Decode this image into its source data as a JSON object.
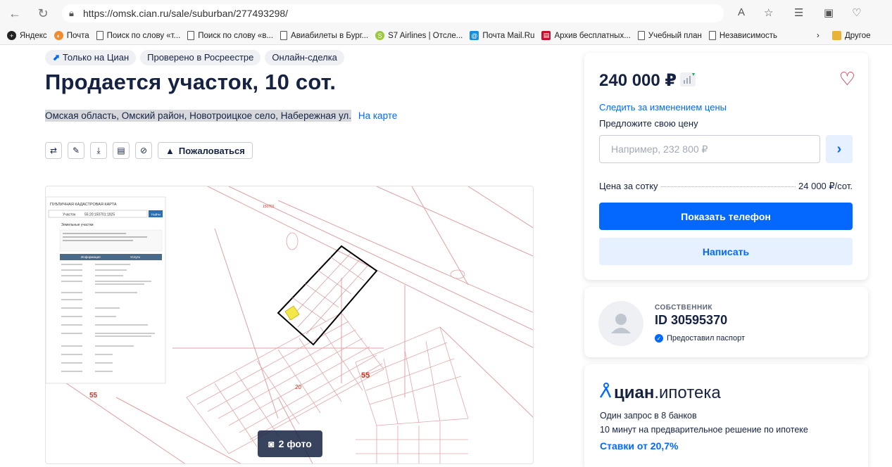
{
  "browser": {
    "url": "https://omsk.cian.ru/sale/suburban/277493298/",
    "bookmarks": [
      {
        "label": "Яндекс",
        "icon": "plus-icon"
      },
      {
        "label": "Почта",
        "icon": "mail-icon"
      },
      {
        "label": "Поиск по слову «т...",
        "icon": "page-icon"
      },
      {
        "label": "Поиск по слову «в...",
        "icon": "page-icon"
      },
      {
        "label": "Авиабилеты в Бург...",
        "icon": "page-icon"
      },
      {
        "label": "S7 Airlines | Отсле...",
        "icon": "s7-icon"
      },
      {
        "label": "Почта Mail.Ru",
        "icon": "mailru-icon"
      },
      {
        "label": "Архив бесплатных...",
        "icon": "archive-icon"
      },
      {
        "label": "Учебный план",
        "icon": "page-icon"
      },
      {
        "label": "Независимость",
        "icon": "page-icon"
      }
    ],
    "other_bookmarks": "Другое"
  },
  "listing": {
    "badges": [
      "Только на Циан",
      "Проверено в Росреестре",
      "Онлайн-сделка"
    ],
    "title": "Продается участок, 10 сот.",
    "address": "Омская область, Омский район, Новотроицкое село, Набережная ул.",
    "map_link": "На карте",
    "complain_label": "Пожаловаться",
    "photo_count_label": "2 фото"
  },
  "map_image": {
    "header": "ПУБЛИЧНАЯ КАДАСТРОВАЯ КАРТА",
    "search_type": "Участок",
    "search_value": "55:20:150701:1925",
    "search_button": "Найти",
    "panel_title": "Земельные участки",
    "tab_info": "Информация",
    "tab_services": "Услуги",
    "label_55_left": "55",
    "label_55_mid": "55",
    "label_20": "20",
    "label_150701": "150701"
  },
  "offer": {
    "price": "240 000 ₽",
    "follow_price": "Следить за изменением цены",
    "offer_label": "Предложите свою цену",
    "offer_placeholder": "Например, 232 800 ₽",
    "per_sotka_label": "Цена за сотку",
    "per_sotka_value": "24 000 ₽/сот.",
    "show_phone": "Показать телефон",
    "write": "Написать"
  },
  "owner": {
    "label": "СОБСТВЕННИК",
    "id": "ID 30595370",
    "passport": "Предоставил паспорт"
  },
  "mortgage": {
    "brand": "циан",
    "product": ".ипотека",
    "line1": "Один запрос в 8 банков",
    "line2": "10 минут на предварительное решение по ипотеке",
    "rates": "Ставки от 20,7%"
  },
  "colors": {
    "accent": "#0468ff",
    "text": "#152242",
    "heart": "#d0021b",
    "cadastral_line": "#e0a0a0",
    "parcel_highlight": "#f3e84a"
  }
}
